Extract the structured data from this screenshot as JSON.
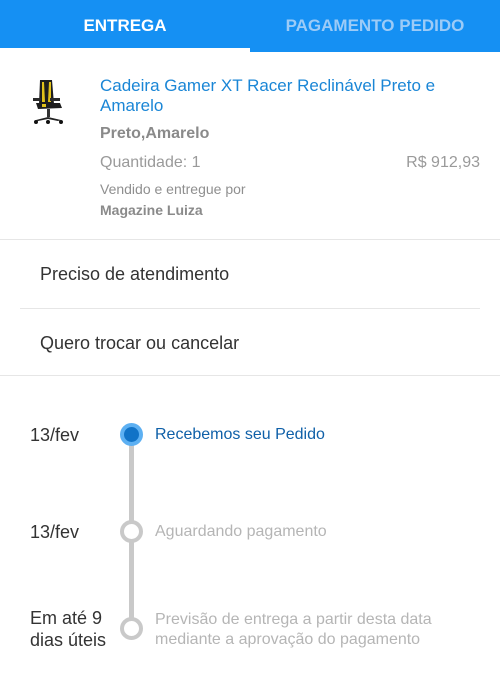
{
  "tabs": [
    {
      "label": "ENTREGA",
      "active": true
    },
    {
      "label": "PAGAMENTO PEDIDO",
      "active": false
    }
  ],
  "product": {
    "title": "Cadeira Gamer XT Racer Reclinável Preto e Amarelo",
    "variant": "Preto,Amarelo",
    "quantity": "Quantidade: 1",
    "price": "R$ 912,93",
    "sold_by_label": "Vendido e entregue por",
    "seller": "Magazine Luiza"
  },
  "menu": {
    "support": "Preciso de atendimento",
    "exchange": "Quero trocar ou cancelar"
  },
  "timeline": [
    {
      "date": "13/fev",
      "label": "Recebemos seu Pedido",
      "status": "done"
    },
    {
      "date": "13/fev",
      "label": "Aguardando pagamento",
      "status": "pending"
    },
    {
      "date_line1": "Em até 9",
      "date_line2": "dias úteis",
      "label_line1": "Previsão de entrega a partir desta data",
      "label_line2": "mediante a aprovação do pagamento",
      "status": "pending"
    }
  ],
  "colors": {
    "header": "#1590f3",
    "link": "#1a86d6",
    "timeline_active": "#1173c7",
    "timeline_pending": "#c9c9c9"
  },
  "icons": {
    "product_image": "gamer-chair-icon"
  }
}
